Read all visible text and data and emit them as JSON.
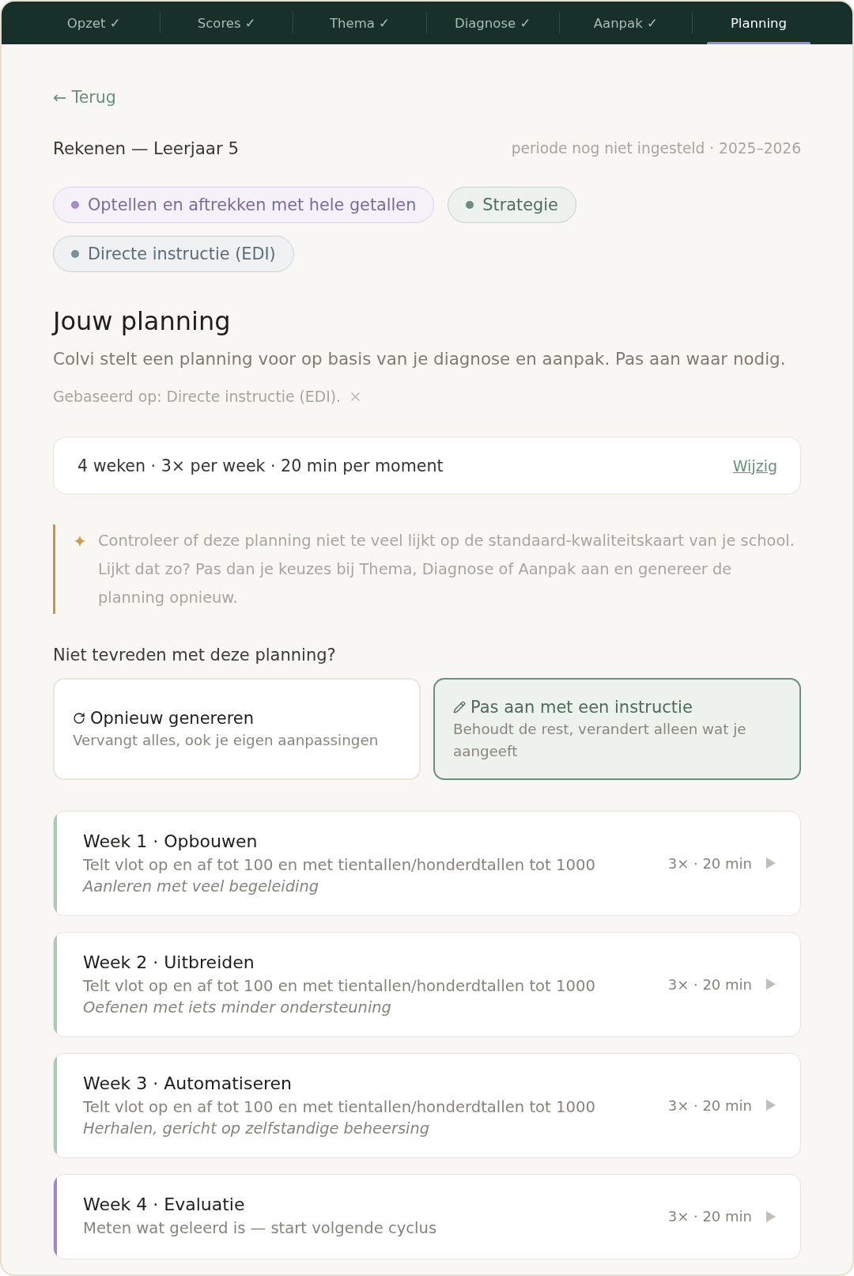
{
  "nav": {
    "tabs": [
      {
        "label": "Opzet ✓",
        "selected": false
      },
      {
        "label": "Scores ✓",
        "selected": false
      },
      {
        "label": "Thema ✓",
        "selected": false
      },
      {
        "label": "Diagnose ✓",
        "selected": false
      },
      {
        "label": "Aanpak ✓",
        "selected": false
      },
      {
        "label": "Planning",
        "selected": true
      }
    ]
  },
  "back_link": "← Terug",
  "header": {
    "title": "Rekenen — Leerjaar 5",
    "meta": "periode nog niet ingesteld · 2025–2026"
  },
  "tags": [
    {
      "label": "Optellen en aftrekken met hele getallen",
      "color": "#a58dcc"
    },
    {
      "label": "Strategie",
      "color": "#6b8f7a"
    },
    {
      "label": "Directe instructie (EDI)",
      "color": "#7b8e98"
    }
  ],
  "planning": {
    "title": "Jouw planning",
    "subtitle": "Colvi stelt een planning voor op basis van je diagnose en aanpak. Pas aan waar nodig.",
    "basis": "Gebaseerd op: Directe instructie (EDI)."
  },
  "summary": {
    "text": "4 weken · 3× per week · 20 min per moment",
    "action": "Wijzig"
  },
  "notice": {
    "text": "Controleer of deze planning niet te veel lijkt op de standaard-kwaliteitskaart van je school. Lijkt dat zo? Pas dan je keuzes bij Thema, Diagnose of Aanpak aan en genereer de planning opnieuw."
  },
  "regenerate": {
    "question": "Niet tevreden met deze planning?",
    "options": [
      {
        "kind": "regenerate",
        "title": "Opnieuw genereren",
        "description": "Vervangt alles, ook je eigen aanpassingen",
        "selected": false
      },
      {
        "kind": "instruct",
        "title": "Pas aan met een instructie",
        "description": "Behoudt de rest, verandert alleen wat je aangeeft",
        "selected": true
      }
    ]
  },
  "weeks": [
    {
      "title": "Week 1 · Opbouwen",
      "goal": "Telt vlot op en af tot 100 en met tientallen/honderdtallen tot 1000",
      "note": "Aanleren met veel begeleiding",
      "schedule": "3× · 20 min",
      "color": "#a6cab3"
    },
    {
      "title": "Week 2 · Uitbreiden",
      "goal": "Telt vlot op en af tot 100 en met tientallen/honderdtallen tot 1000",
      "note": "Oefenen met iets minder ondersteuning",
      "schedule": "3× · 20 min",
      "color": "#a6cab3"
    },
    {
      "title": "Week 3 · Automatiseren",
      "goal": "Telt vlot op en af tot 100 en met tientallen/honderdtallen tot 1000",
      "note": "Herhalen, gericht op zelfstandige beheersing",
      "schedule": "3× · 20 min",
      "color": "#a6cab3"
    },
    {
      "title": "Week 4 · Evaluatie",
      "goal": "Meten wat geleerd is — start volgende cyclus",
      "schedule": "3× · 20 min",
      "color": "#9c86cf"
    }
  ]
}
